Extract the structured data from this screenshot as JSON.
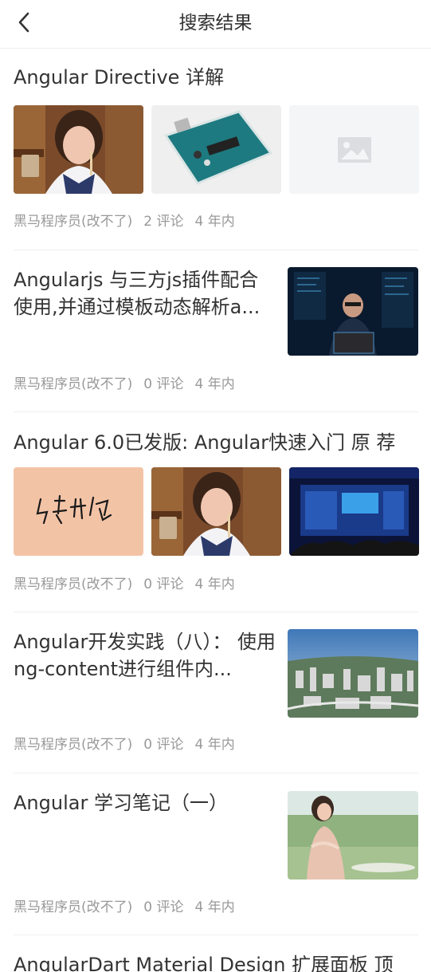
{
  "header": {
    "title": "搜索结果",
    "back_icon": "chevron-left-icon"
  },
  "articles": [
    {
      "title": "Angular Directive 详解",
      "author": "黑马程序员(改不了)",
      "comments": "2 评论",
      "time": "4 年内",
      "images": [
        "girl-portrait-image",
        "arduino-board-image",
        "image-placeholder-icon"
      ]
    },
    {
      "title": "Angularjs 与三方js插件配合使用,并通过模板动态解析a...",
      "author": "黑马程序员(改不了)",
      "comments": "0 评论",
      "time": "4 年内",
      "images": [
        "programmer-laptop-image"
      ]
    },
    {
      "title": "Angular 6.0已发版: Angular快速入门 原 荐",
      "author": "黑马程序员(改不了)",
      "comments": "0 评论",
      "time": "4 年内",
      "images": [
        "calligraphy-image",
        "girl-portrait-image",
        "conference-stage-image"
      ]
    },
    {
      "title": "Angular开发实践（八）： 使用ng-content进行组件内...",
      "author": "黑马程序员(改不了)",
      "comments": "0 评论",
      "time": "4 年内",
      "images": [
        "city-aerial-image"
      ]
    },
    {
      "title": "Angular 学习笔记（一）",
      "author": "黑马程序员(改不了)",
      "comments": "0 评论",
      "time": "4 年内",
      "images": [
        "woman-outdoor-image"
      ]
    },
    {
      "title": "AngularDart Material Design 扩展面板 顶"
    }
  ]
}
